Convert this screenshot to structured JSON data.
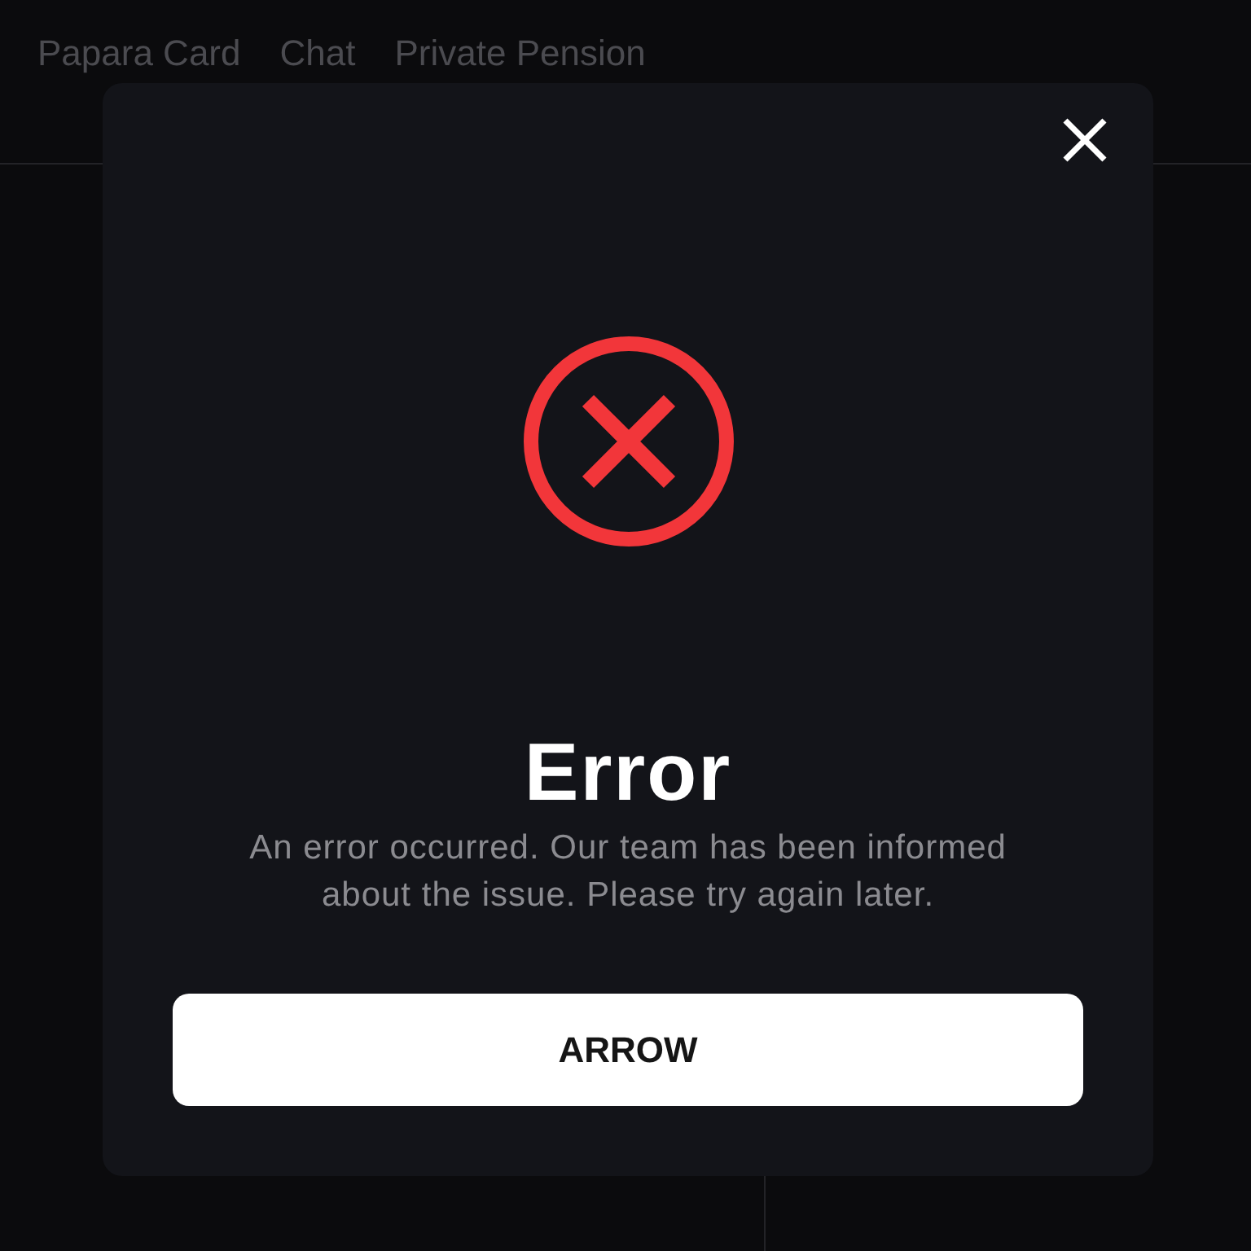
{
  "nav": {
    "links": [
      {
        "label": "Papara Card"
      },
      {
        "label": "Chat"
      },
      {
        "label": "Private Pension"
      }
    ]
  },
  "dialog": {
    "kind": "error",
    "title": "Error",
    "message": "An error occurred. Our team has been informed about the issue. Please try again later.",
    "button": "ARROW"
  }
}
